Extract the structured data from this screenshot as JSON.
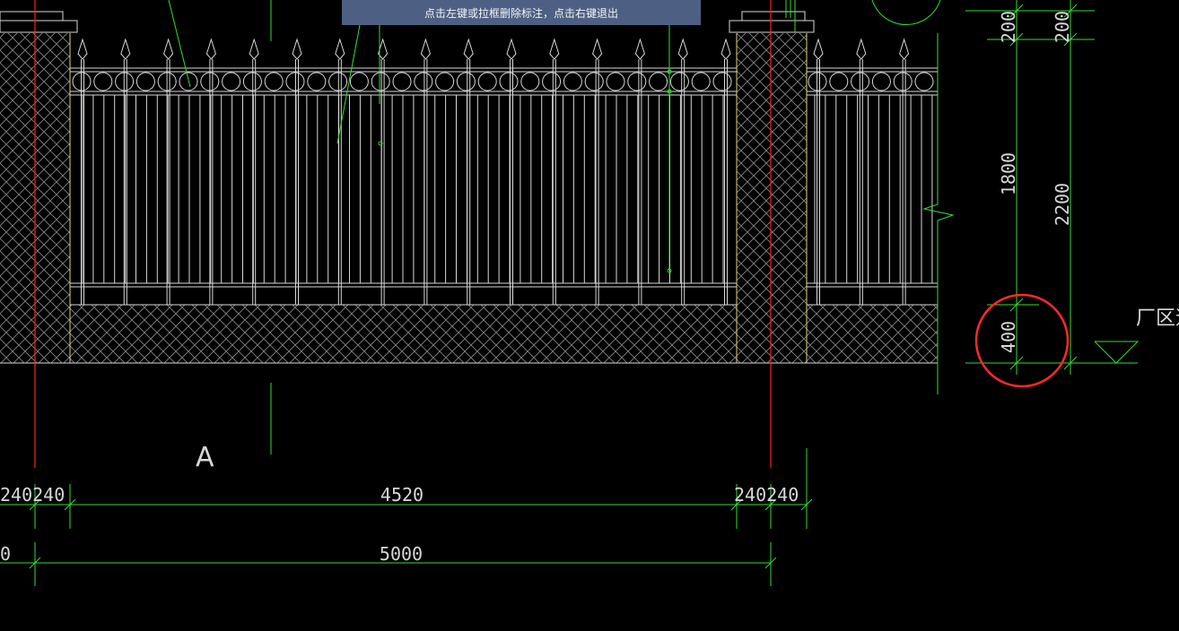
{
  "prompt": {
    "message": "点击左键或拉框删除标注，点击右键退出"
  },
  "drawing": {
    "grid_label": "A",
    "side_label": "厂区道",
    "dimensions": {
      "bottom_row1": {
        "left_partial": "240240",
        "middle": "4520",
        "right": "240240"
      },
      "bottom_row2": {
        "left_partial": "0",
        "middle": "5000"
      },
      "vertical_inner": {
        "top": "200",
        "middle": "1800",
        "bottom": "400"
      },
      "vertical_outer": {
        "top": "200",
        "total": "2200"
      },
      "highlight_marker": "400"
    },
    "colors": {
      "background": "#000000",
      "fence": "#d8d8d8",
      "dimension": "#33dd33",
      "axis": "#ff2020",
      "marker": "#ff2a2a",
      "wall": "#e6d07a",
      "prompt_bar": "#4d6083"
    }
  }
}
